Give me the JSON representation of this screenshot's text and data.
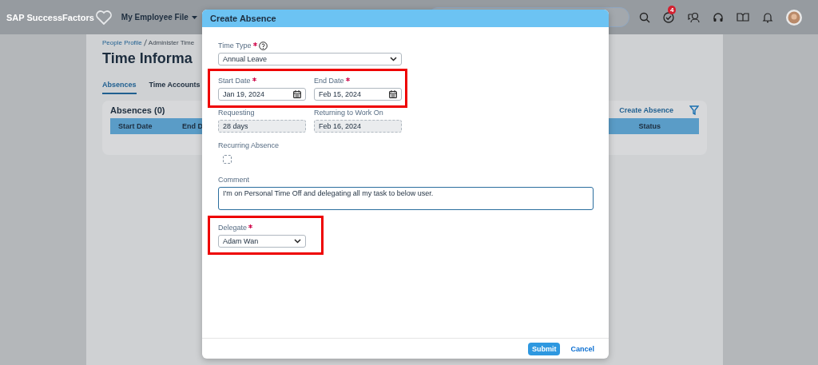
{
  "header": {
    "logo": "SAP SuccessFactors",
    "menu": "My Employee File",
    "badge": "4"
  },
  "page": {
    "breadcrumb": [
      {
        "label": "People Profile"
      },
      {
        "label": "Administer Time"
      }
    ],
    "title": "Time Informa",
    "tabs": [
      {
        "label": "Absences",
        "selected": true
      },
      {
        "label": "Time Accounts",
        "selected": false
      }
    ],
    "card": {
      "title": "Absences (0)",
      "action": "Create Absence",
      "columns": [
        "Start Date",
        "End D",
        "Status"
      ]
    }
  },
  "dialog": {
    "title": "Create Absence",
    "time_type": {
      "label": "Time Type",
      "required": true,
      "value": "Annual Leave"
    },
    "dates": {
      "highlighted": true,
      "fields": [
        {
          "label": "Start Date",
          "required": true,
          "value": "Jan 19, 2024"
        },
        {
          "label": "End Date",
          "required": true,
          "value": "Feb 15, 2024"
        }
      ]
    },
    "computed": [
      {
        "label": "Requesting",
        "value": "28 days"
      },
      {
        "label": "Returning to Work On",
        "value": "Feb 16, 2024"
      }
    ],
    "recurring": {
      "label": "Recurring Absence",
      "checked": false
    },
    "comment": {
      "label": "Comment",
      "value": "I'm on Personal Time Off and delegating all my task to below user."
    },
    "delegate": {
      "highlighted": true,
      "label": "Delegate",
      "required": true,
      "value": "Adam Wan"
    },
    "buttons": [
      {
        "label": "Submit",
        "kind": "primary"
      },
      {
        "label": "Cancel",
        "kind": "link"
      }
    ]
  }
}
